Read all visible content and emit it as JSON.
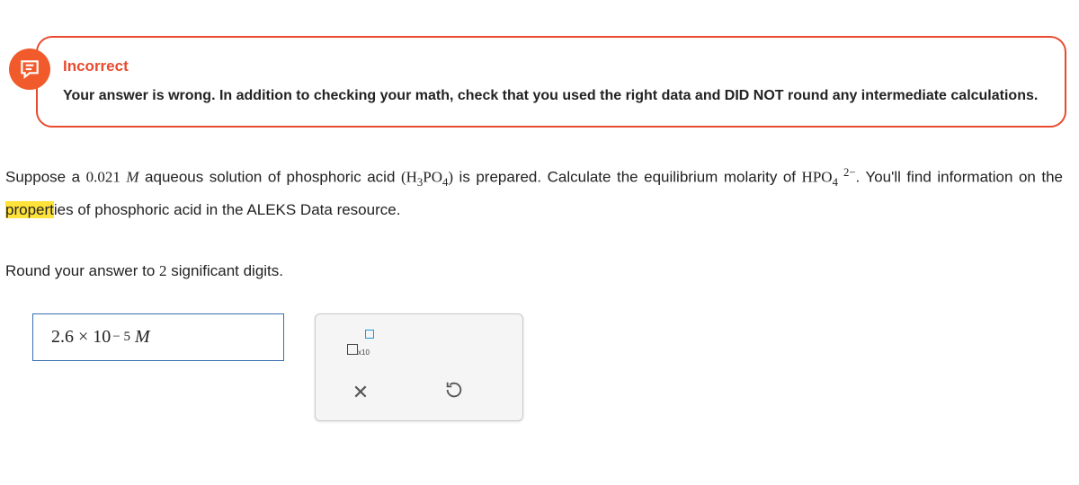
{
  "feedback": {
    "title": "Incorrect",
    "message": "Your answer is wrong. In addition to checking your math, check that you used the right data and DID NOT round any intermediate calculations."
  },
  "question": {
    "part1": "Suppose a ",
    "concentration": "0.021",
    "unit_M": "M",
    "part2": " aqueous solution of phosphoric acid ",
    "formula_open": "(H",
    "formula_sub1": "3",
    "formula_mid": "PO",
    "formula_sub2": "4",
    "formula_close": ")",
    "part3": " is prepared. Calculate the equilibrium molarity of ",
    "species": "HPO",
    "species_sub": "4",
    "species_sup": "2−",
    "part4": ". You'll find information on the ",
    "highlight": "propert",
    "after_hl": "ies",
    "part5": " of phosphoric acid in the ALEKS Data resource.",
    "round_pre": "Round your answer to ",
    "round_n": "2",
    "round_post": " significant digits."
  },
  "answer": {
    "coef": "2.6",
    "times": "×",
    "base": "10",
    "exp": "− 5",
    "unit": "M"
  },
  "tools": {
    "sci_x10": "x10"
  }
}
